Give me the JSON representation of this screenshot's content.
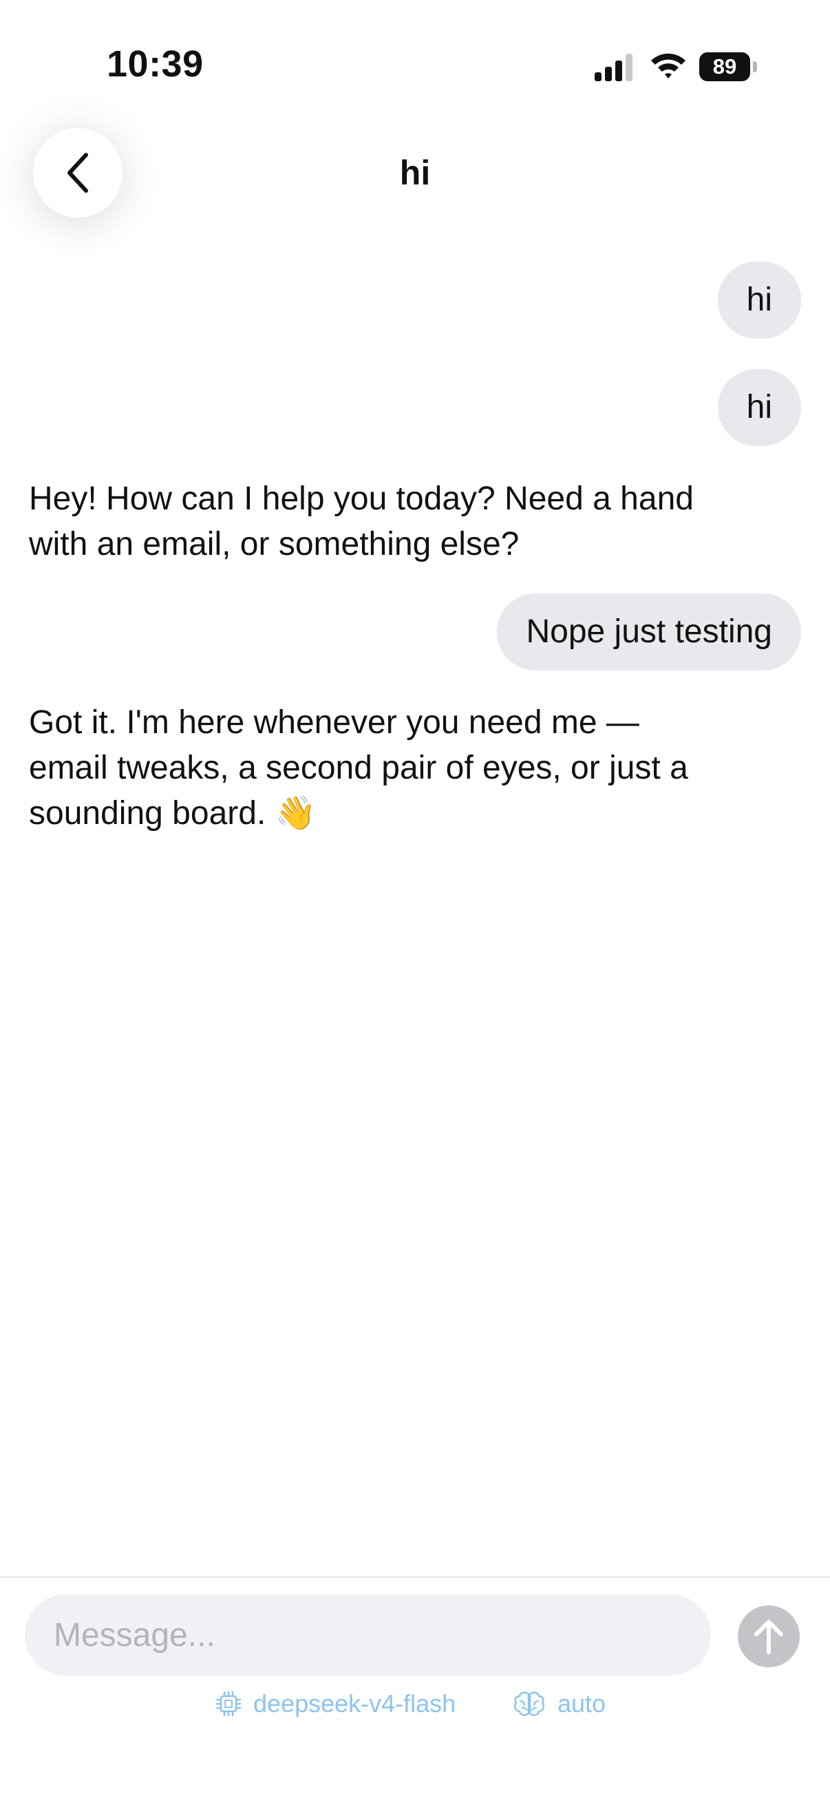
{
  "status_bar": {
    "time": "10:39",
    "battery": "89",
    "icons": [
      "signal-icon",
      "wifi-icon",
      "battery-icon"
    ]
  },
  "header": {
    "title": "hi",
    "back_icon": "chevron-left-icon"
  },
  "messages": [
    {
      "role": "user",
      "text": "hi"
    },
    {
      "role": "user",
      "text": "hi"
    },
    {
      "role": "assistant",
      "text": "Hey! How can I help you today? Need a hand with an email, or something else?"
    },
    {
      "role": "user",
      "text": "Nope just testing"
    },
    {
      "role": "assistant",
      "text": "Got it. I'm here whenever you need me — email tweaks, a second pair of eyes, or just a sounding board. 👋"
    }
  ],
  "composer": {
    "placeholder": "Message...",
    "value": "",
    "send_icon": "arrow-up-icon",
    "model": {
      "icon": "chip-icon",
      "label": "deepseek-v4-flash"
    },
    "mode": {
      "icon": "brain-icon",
      "label": "auto"
    }
  },
  "colors": {
    "background": "#ffffff",
    "user_bubble": "#e8e8ed",
    "input_background": "#f1f1f5",
    "send_button": "#c4c4c8",
    "accent_link": "#8fc3ee",
    "text": "#111111"
  }
}
